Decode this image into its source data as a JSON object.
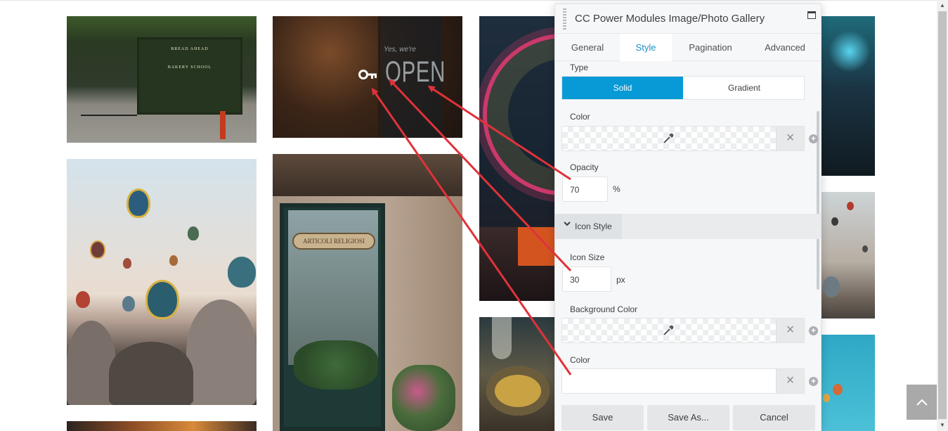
{
  "gallery": {
    "store_sign_1": "BREAD AHEAD",
    "store_sign_2": "BAKERY SCHOOL",
    "window_tagline": "Yes, we're",
    "window_open_text": "OPEN",
    "window_icon": "key-icon",
    "shop_sign": "ARTICOLI RELIGIOSI"
  },
  "panel": {
    "title": "CC Power Modules Image/Photo Gallery",
    "tabs": [
      "General",
      "Style",
      "Pagination",
      "Advanced"
    ],
    "active_tab": "Style",
    "type_label": "Type",
    "type_options": [
      "Solid",
      "Gradient"
    ],
    "type_selected": "Solid",
    "color_label": "Color",
    "opacity_label": "Opacity",
    "opacity_value": "70",
    "opacity_unit": "%",
    "icon_section": "Icon Style",
    "icon_size_label": "Icon Size",
    "icon_size_value": "30",
    "icon_size_unit": "px",
    "bg_color_label": "Background Color",
    "icon_color_label": "Color",
    "buttons": {
      "save": "Save",
      "save_as": "Save As...",
      "cancel": "Cancel"
    }
  },
  "colors": {
    "accent": "#079ad6",
    "active_tab_text": "#1e8fc6",
    "annotation_arrow": "#e0323a"
  }
}
